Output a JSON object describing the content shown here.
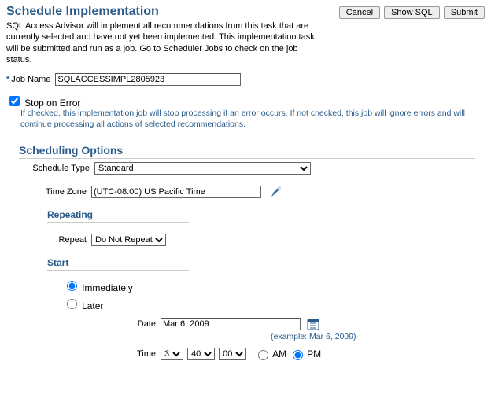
{
  "header": {
    "title": "Schedule Implementation",
    "intro": "SQL Access Advisor will implement all recommendations from this task that are currently selected and have not yet been implemented. This implementation task will be submitted and run as a job. Go to Scheduler Jobs to check on the job status.",
    "buttons": {
      "cancel": "Cancel",
      "show_sql": "Show SQL",
      "submit": "Submit"
    }
  },
  "job_name": {
    "label": "Job Name",
    "value": "SQLACCESSIMPL2805923"
  },
  "stop_on_error": {
    "label": "Stop on Error",
    "checked": true,
    "help": "If checked, this implementation job will stop processing if an error occurs. If not checked, this job will ignore errors and will continue processing all actions of selected recommendations."
  },
  "scheduling": {
    "title": "Scheduling Options",
    "schedule_type": {
      "label": "Schedule Type",
      "value": "Standard"
    },
    "time_zone": {
      "label": "Time Zone",
      "value": "(UTC-08:00) US Pacific Time"
    },
    "repeating": {
      "title": "Repeating",
      "repeat_label": "Repeat",
      "repeat_value": "Do Not Repeat"
    },
    "start": {
      "title": "Start",
      "immediately": "Immediately",
      "later": "Later",
      "selected": "immediately",
      "date_label": "Date",
      "date_value": "Mar 6, 2009",
      "date_example": "(example: Mar 6, 2009)",
      "time_label": "Time",
      "time_hour": "3",
      "time_minute": "40",
      "time_second": "00",
      "am": "AM",
      "pm": "PM",
      "ampm_selected": "pm"
    }
  }
}
